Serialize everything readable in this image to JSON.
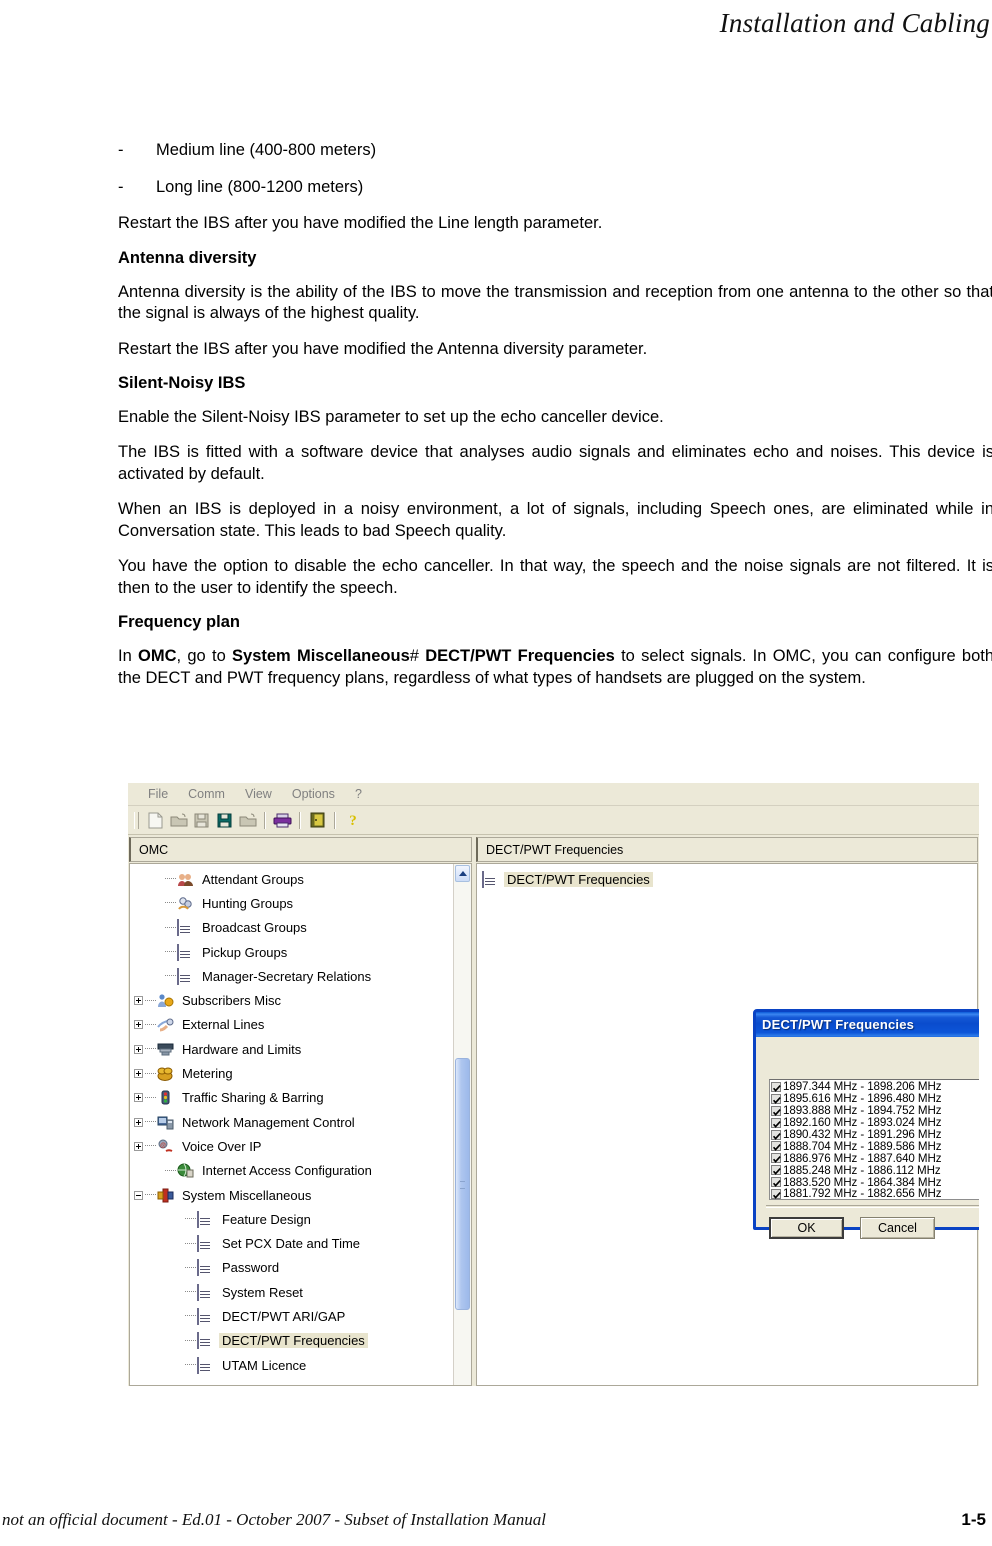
{
  "header": {
    "title": "Installation and Cabling"
  },
  "document": {
    "bullets": [
      {
        "marker": "-",
        "text": "Medium line (400-800 meters)"
      },
      {
        "marker": "-",
        "text": "Long line (800-1200 meters)"
      }
    ],
    "p_restart_line_length": "Restart the IBS after you have modified the Line length parameter.",
    "h_antenna_diversity": "Antenna diversity",
    "p_antenna_diversity": "Antenna diversity is the ability of the IBS to move the transmission and reception from one antenna to the other so that the signal is always of the highest quality.",
    "p_restart_antenna": "Restart the IBS after you have modified the Antenna diversity parameter.",
    "h_silent_noisy": "Silent-Noisy IBS",
    "p_enable_silent_noisy": "Enable the Silent-Noisy IBS parameter to set up the echo canceller device.",
    "p_software_device": "The IBS is fitted with a software device that analyses audio signals and eliminates echo and noises. This device is activated by default.",
    "p_noisy_env": "When an IBS is deployed in a noisy environment, a lot of signals, including Speech ones, are eliminated while in Conversation state. This leads to bad Speech quality.",
    "p_disable_echo": "You have the option to disable the echo canceller. In that way, the speech and the noise signals are not filtered. It is then to the user to identify the speech.",
    "h_frequency_plan": "Frequency plan",
    "p_frequency_plan": {
      "t1": "In ",
      "b1": "OMC",
      "t2": ", go to ",
      "b2": "System Miscellaneous",
      "t3": "# ",
      "b3": "DECT/PWT Frequencies",
      "t4": " to select signals. In OMC, you can configure both the DECT and PWT frequency plans, regardless of what types of handsets are plugged on the system."
    }
  },
  "screenshot": {
    "menu": [
      "File",
      "Comm",
      "View",
      "Options",
      "?"
    ],
    "toolbar_icons": [
      "new-document-icon",
      "open-folder-icon",
      "save-icon",
      "save-active-icon",
      "open-folder-2-icon",
      "print-icon",
      "exit-door-icon",
      "help-icon"
    ],
    "left_panel": {
      "caption": "OMC",
      "tree": [
        {
          "label": "Attendant Groups",
          "indent": 1,
          "expander": "none",
          "icon": "attendant-groups-icon"
        },
        {
          "label": "Hunting Groups",
          "indent": 1,
          "expander": "none",
          "icon": "hunting-groups-icon"
        },
        {
          "label": "Broadcast Groups",
          "indent": 1,
          "expander": "none",
          "icon": "form-icon"
        },
        {
          "label": "Pickup Groups",
          "indent": 1,
          "expander": "none",
          "icon": "form-icon"
        },
        {
          "label": "Manager-Secretary Relations",
          "indent": 1,
          "expander": "none",
          "icon": "form-icon"
        },
        {
          "label": "Subscribers Misc",
          "indent": 0,
          "expander": "plus",
          "icon": "subscribers-misc-icon"
        },
        {
          "label": "External Lines",
          "indent": 0,
          "expander": "plus",
          "icon": "external-lines-icon"
        },
        {
          "label": "Hardware and Limits",
          "indent": 0,
          "expander": "plus",
          "icon": "hardware-limits-icon"
        },
        {
          "label": "Metering",
          "indent": 0,
          "expander": "plus",
          "icon": "metering-icon"
        },
        {
          "label": "Traffic Sharing & Barring",
          "indent": 0,
          "expander": "plus",
          "icon": "traffic-sharing-icon"
        },
        {
          "label": "Network Management Control",
          "indent": 0,
          "expander": "plus",
          "icon": "network-management-icon"
        },
        {
          "label": "Voice Over IP",
          "indent": 0,
          "expander": "plus",
          "icon": "voice-over-ip-icon"
        },
        {
          "label": "Internet Access Configuration",
          "indent": 1,
          "expander": "none",
          "icon": "internet-access-icon"
        },
        {
          "label": "System Miscellaneous",
          "indent": 0,
          "expander": "minus",
          "icon": "system-misc-icon"
        },
        {
          "label": "Feature Design",
          "indent": 2,
          "expander": "none",
          "icon": "form-icon"
        },
        {
          "label": "Set PCX Date and Time",
          "indent": 2,
          "expander": "none",
          "icon": "form-icon"
        },
        {
          "label": "Password",
          "indent": 2,
          "expander": "none",
          "icon": "form-icon"
        },
        {
          "label": "System Reset",
          "indent": 2,
          "expander": "none",
          "icon": "form-icon"
        },
        {
          "label": "DECT/PWT ARI/GAP",
          "indent": 2,
          "expander": "none",
          "icon": "form-icon"
        },
        {
          "label": "DECT/PWT Frequencies",
          "indent": 2,
          "expander": "none",
          "icon": "form-icon",
          "selected": true
        },
        {
          "label": "UTAM Licence",
          "indent": 2,
          "expander": "none",
          "icon": "form-icon"
        }
      ]
    },
    "right_panel": {
      "caption": "DECT/PWT Frequencies",
      "items": [
        {
          "label": "DECT/PWT Frequencies",
          "icon": "form-icon",
          "selected": true
        }
      ]
    },
    "dialog": {
      "title": "DECT/PWT Frequencies",
      "close_label": "✕",
      "frequencies": [
        {
          "label": "1897.344 MHz - 1898.206 MHz",
          "checked": true
        },
        {
          "label": "1895.616 MHz - 1896.480 MHz",
          "checked": true
        },
        {
          "label": "1893.888 MHz - 1894.752 MHz",
          "checked": true
        },
        {
          "label": "1892.160 MHz - 1893.024 MHz",
          "checked": true
        },
        {
          "label": "1890.432 MHz - 1891.296 MHz",
          "checked": true
        },
        {
          "label": "1888.704 MHz - 1889.586 MHz",
          "checked": true
        },
        {
          "label": "1886.976 MHz - 1887.640 MHz",
          "checked": true
        },
        {
          "label": "1885.248 MHz - 1886.112 MHz",
          "checked": true
        },
        {
          "label": "1883.520 MHz - 1864.384 MHz",
          "checked": true
        },
        {
          "label": "1881.792 MHz - 1882.656 MHz",
          "checked": true
        }
      ],
      "ok_label": "OK",
      "cancel_label": "Cancel"
    }
  },
  "footer": {
    "note": "not an official document - Ed.01 - October 2007 - Subset of Installation Manual",
    "page": "1-5"
  }
}
